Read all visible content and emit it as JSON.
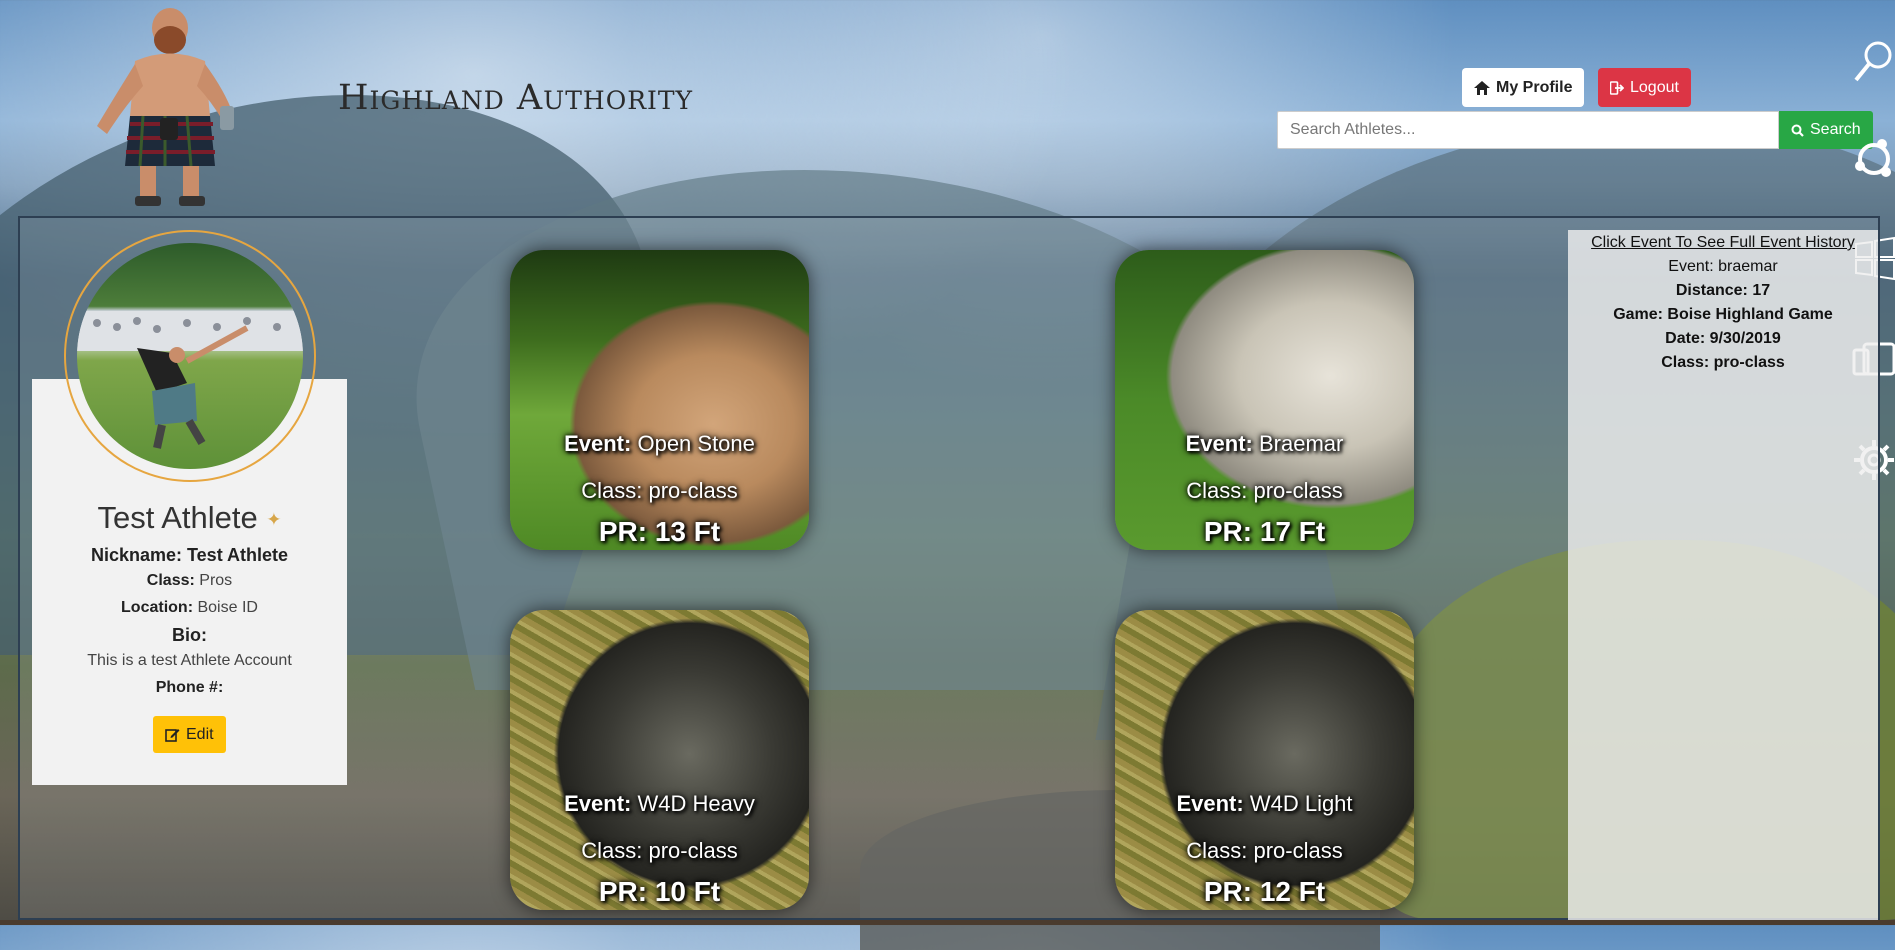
{
  "header": {
    "brand": "Highland Authority",
    "my_profile_label": "My Profile",
    "logout_label": "Logout",
    "search_placeholder": "Search Athletes...",
    "search_label": "Search"
  },
  "profile": {
    "name": "Test Athlete",
    "nickname_label": "Nickname:",
    "nickname": "Test Athlete",
    "class_label": "Class:",
    "class": "Pros",
    "location_label": "Location:",
    "location": "Boise ID",
    "bio_label": "Bio:",
    "bio": "This is a test Athlete Account",
    "phone_label": "Phone #:",
    "edit_label": "Edit"
  },
  "events": [
    {
      "event_label": "Event:",
      "name": "Open Stone",
      "class": "Class: pro-class",
      "pr": "PR: 13 Ft",
      "image": "stone"
    },
    {
      "event_label": "Event:",
      "name": "Braemar",
      "class": "Class: pro-class",
      "pr": "PR: 17 Ft",
      "image": "stone"
    },
    {
      "event_label": "Event:",
      "name": "W4D Heavy",
      "class": "Class: pro-class",
      "pr": "PR: 10 Ft",
      "image": "weight"
    },
    {
      "event_label": "Event:",
      "name": "W4D Light",
      "class": "Class: pro-class",
      "pr": "PR: 12 Ft",
      "image": "weight"
    }
  ],
  "history": {
    "link": "Click Event To See Full Event History",
    "event": "Event: braemar",
    "distance": "Distance: 17",
    "game": "Game: Boise Highland Game",
    "date": "Date: 9/30/2019",
    "class": "Class: pro-class"
  },
  "edge_icons": [
    "magnifier-icon",
    "share-icon",
    "windows-icon",
    "devices-icon",
    "gear-icon"
  ],
  "colors": {
    "logout": "#dc3545",
    "search": "#28a745",
    "edit": "#ffc107",
    "avatar_ring": "#e6a640"
  }
}
